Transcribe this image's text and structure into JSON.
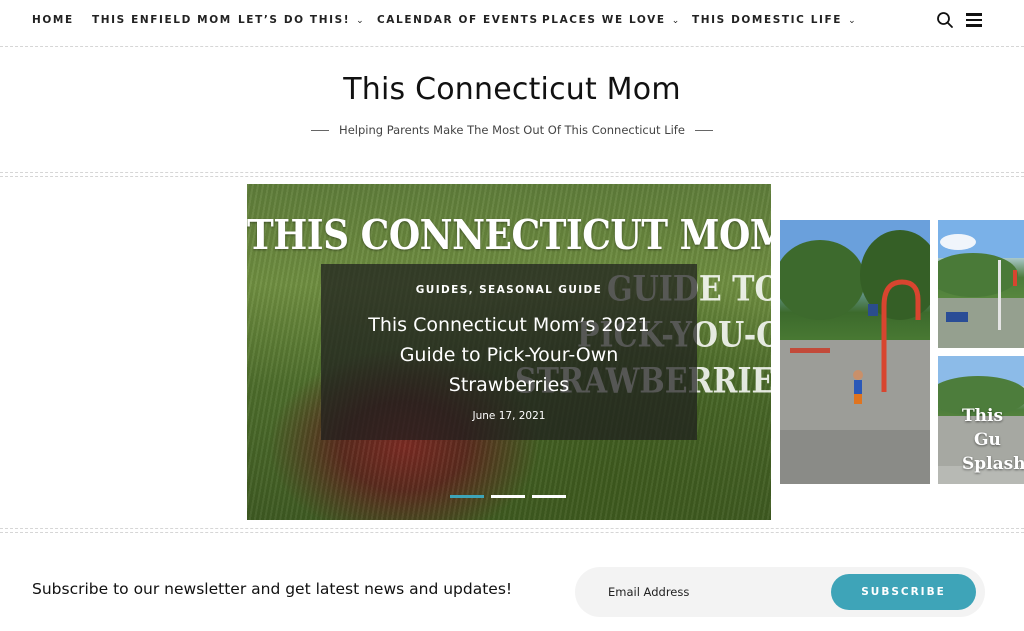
{
  "nav": {
    "items": [
      {
        "label": "HOME",
        "has_dropdown": false
      },
      {
        "label": "THIS ENFIELD MOM",
        "has_dropdown": false
      },
      {
        "label": "LET’S DO THIS!",
        "has_dropdown": true
      },
      {
        "label": "CALENDAR OF EVENTS",
        "has_dropdown": false
      },
      {
        "label": "PLACES WE LOVE",
        "has_dropdown": true
      },
      {
        "label": "THIS DOMESTIC LIFE",
        "has_dropdown": true
      }
    ],
    "chevron": "⌄",
    "icons": {
      "search": "search-icon",
      "menu": "hamburger-menu-icon"
    }
  },
  "header": {
    "title": "This Connecticut Mom",
    "tagline": "Helping Parents Make The Most Out Of This Connecticut Life"
  },
  "slider": {
    "featured": {
      "banner_text": "THIS CONNECTICUT MOM'S",
      "banner_side": [
        "GUIDE TO",
        "PICK-YOU-OWN",
        "STRAWBERRIES"
      ],
      "categories": "GUIDES, SEASONAL GUIDE",
      "title": "This Connecticut Mom’s 2021 Guide to Pick-Your-Own Strawberries",
      "date": "June 17, 2021"
    },
    "active_dot": 0,
    "dot_count": 3,
    "thumb3_text": [
      "This",
      "Gu",
      "Splash"
    ]
  },
  "newsletter": {
    "text": "Subscribe to our newsletter and get latest news and updates!",
    "placeholder": "Email Address",
    "button": "SUBSCRIBE"
  },
  "colors": {
    "accent": "#3ea4b8",
    "overlay": "#1e1e1e",
    "input_bg": "#f3f3f3"
  }
}
